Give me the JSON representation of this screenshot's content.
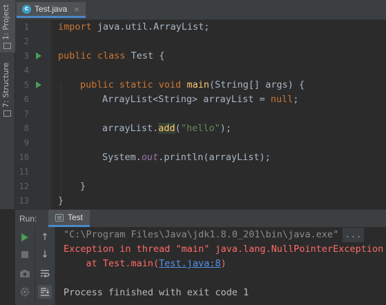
{
  "side_panel": {
    "project_label": "1: Project",
    "structure_label": "7: Structure"
  },
  "editor_tab": {
    "icon": "class-icon",
    "icon_letter": "c",
    "filename": "Test.java",
    "close": "×"
  },
  "code": {
    "line_numbers": [
      "1",
      "2",
      "3",
      "4",
      "5",
      "6",
      "7",
      "8",
      "9",
      "10",
      "11",
      "12",
      "13"
    ],
    "l1": {
      "kw": "import",
      "rest": " java.util.ArrayList;"
    },
    "l3": {
      "kw": "public class",
      "rest": " Test {"
    },
    "l5": {
      "kw": "public static void",
      "fn": "main",
      "rest": "(String[] args) {"
    },
    "l6": {
      "pre": "ArrayList<String> arrayList = ",
      "kw": "null",
      "post": ";"
    },
    "l8": {
      "pre": "arrayList.",
      "fn": "add",
      "open": "(",
      "str": "\"hello\"",
      "close": ");"
    },
    "l10": {
      "pre": "System.",
      "fld": "out",
      "post": ".println(arrayList);"
    },
    "l12": {
      "text": "}"
    },
    "l13": {
      "text": "}"
    }
  },
  "run_panel": {
    "label": "Run:",
    "tab_name": "Test",
    "console": {
      "cmd": "\"C:\\Program Files\\Java\\jdk1.8.0_201\\bin\\java.exe\"",
      "cmd_more": "...",
      "exception": "Exception in thread \"main\" java.lang.NullPointerException",
      "trace_prefix": "    at Test.main(",
      "trace_link": "Test.java:8",
      "trace_suffix": ")",
      "exit": "Process finished with exit code 1"
    },
    "toolbar": {
      "rerun": "play-icon",
      "stop": "stop-icon",
      "camera": "camera-icon",
      "settings": "gear-icon",
      "up": "↑",
      "down": "↓",
      "wrap": "soft-wrap-icon",
      "scroll_end": "scroll-to-end-icon"
    }
  },
  "colors": {
    "keyword": "#cc7832",
    "function": "#ffc66d",
    "string": "#6a8759",
    "error": "#ff6b68",
    "link": "#5394ec"
  }
}
